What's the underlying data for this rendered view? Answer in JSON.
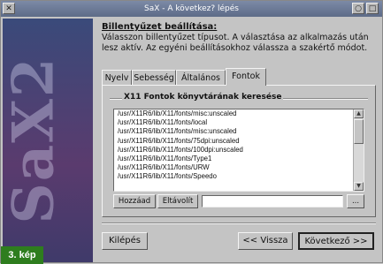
{
  "window": {
    "title": "SaX - A következ? lépés"
  },
  "sidebar": {
    "logo_text": "SaX2",
    "figure_label": "3. kép"
  },
  "content": {
    "heading": "Billentyűzet beállítása:",
    "description": "Válasszon billentyűzet típusot. A választása az alkalmazás után lesz aktív. Az egyéni beállításokhoz válassza a szakértő módot."
  },
  "tabs": [
    {
      "label": "Nyelv"
    },
    {
      "label": "Sebesség"
    },
    {
      "label": "Általános"
    },
    {
      "label": "Fontok"
    }
  ],
  "active_tab": "Fontok",
  "fonts_group": {
    "title": "X11 Fontok könyvtárának keresése",
    "paths": [
      "/usr/X11R6/lib/X11/fonts/misc:unscaled",
      "/usr/X11R6/lib/X11/fonts/local",
      "/usr/X11R6/lib/X11/fonts/misc:unscaled",
      "/usr/X11R6/lib/X11/fonts/75dpi:unscaled",
      "/usr/X11R6/lib/X11/fonts/100dpi:unscaled",
      "/usr/X11R6/lib/X11/fonts/Type1",
      "/usr/X11R6/lib/X11/fonts/URW",
      "/usr/X11R6/lib/X11/fonts/Speedo"
    ],
    "add_label": "Hozzáad",
    "remove_label": "Eltávolít",
    "path_value": "",
    "browse_label": "..."
  },
  "footer": {
    "exit_label": "Kilépés",
    "back_label": "<< Vissza",
    "next_label": "Következő >>"
  }
}
